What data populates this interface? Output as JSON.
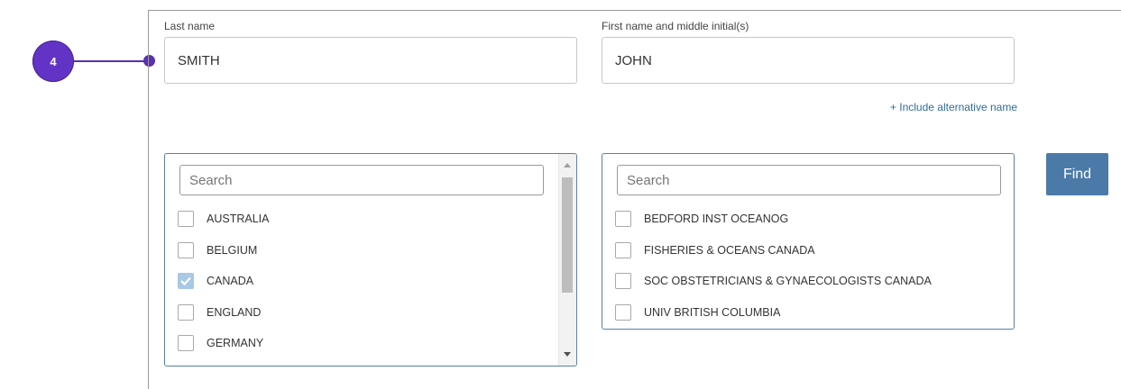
{
  "step": {
    "number": "4"
  },
  "name_fields": {
    "last_name_label": "Last name",
    "last_name_value": "SMITH",
    "first_name_label": "First name and middle initial(s)",
    "first_name_value": "JOHN",
    "alternative_name_link": "+ Include alternative name"
  },
  "country_filter": {
    "placeholder": "Search",
    "options": [
      {
        "label": "AUSTRALIA",
        "checked": false
      },
      {
        "label": "BELGIUM",
        "checked": false
      },
      {
        "label": "CANADA",
        "checked": true
      },
      {
        "label": "ENGLAND",
        "checked": false
      },
      {
        "label": "GERMANY",
        "checked": false
      }
    ]
  },
  "organization_filter": {
    "placeholder": "Search",
    "options": [
      {
        "label": "BEDFORD INST OCEANOG",
        "checked": false
      },
      {
        "label": "FISHERIES & OCEANS CANADA",
        "checked": false
      },
      {
        "label": "SOC OBSTETRICIANS & GYNAECOLOGISTS CANADA",
        "checked": false
      },
      {
        "label": "UNIV BRITISH COLUMBIA",
        "checked": false
      }
    ]
  },
  "find_button": {
    "label": "Find"
  },
  "colors": {
    "callout": "#6233c5",
    "accent": "#4b7aa8",
    "link": "#2f6d9a",
    "checked": "#a8c8e4"
  }
}
